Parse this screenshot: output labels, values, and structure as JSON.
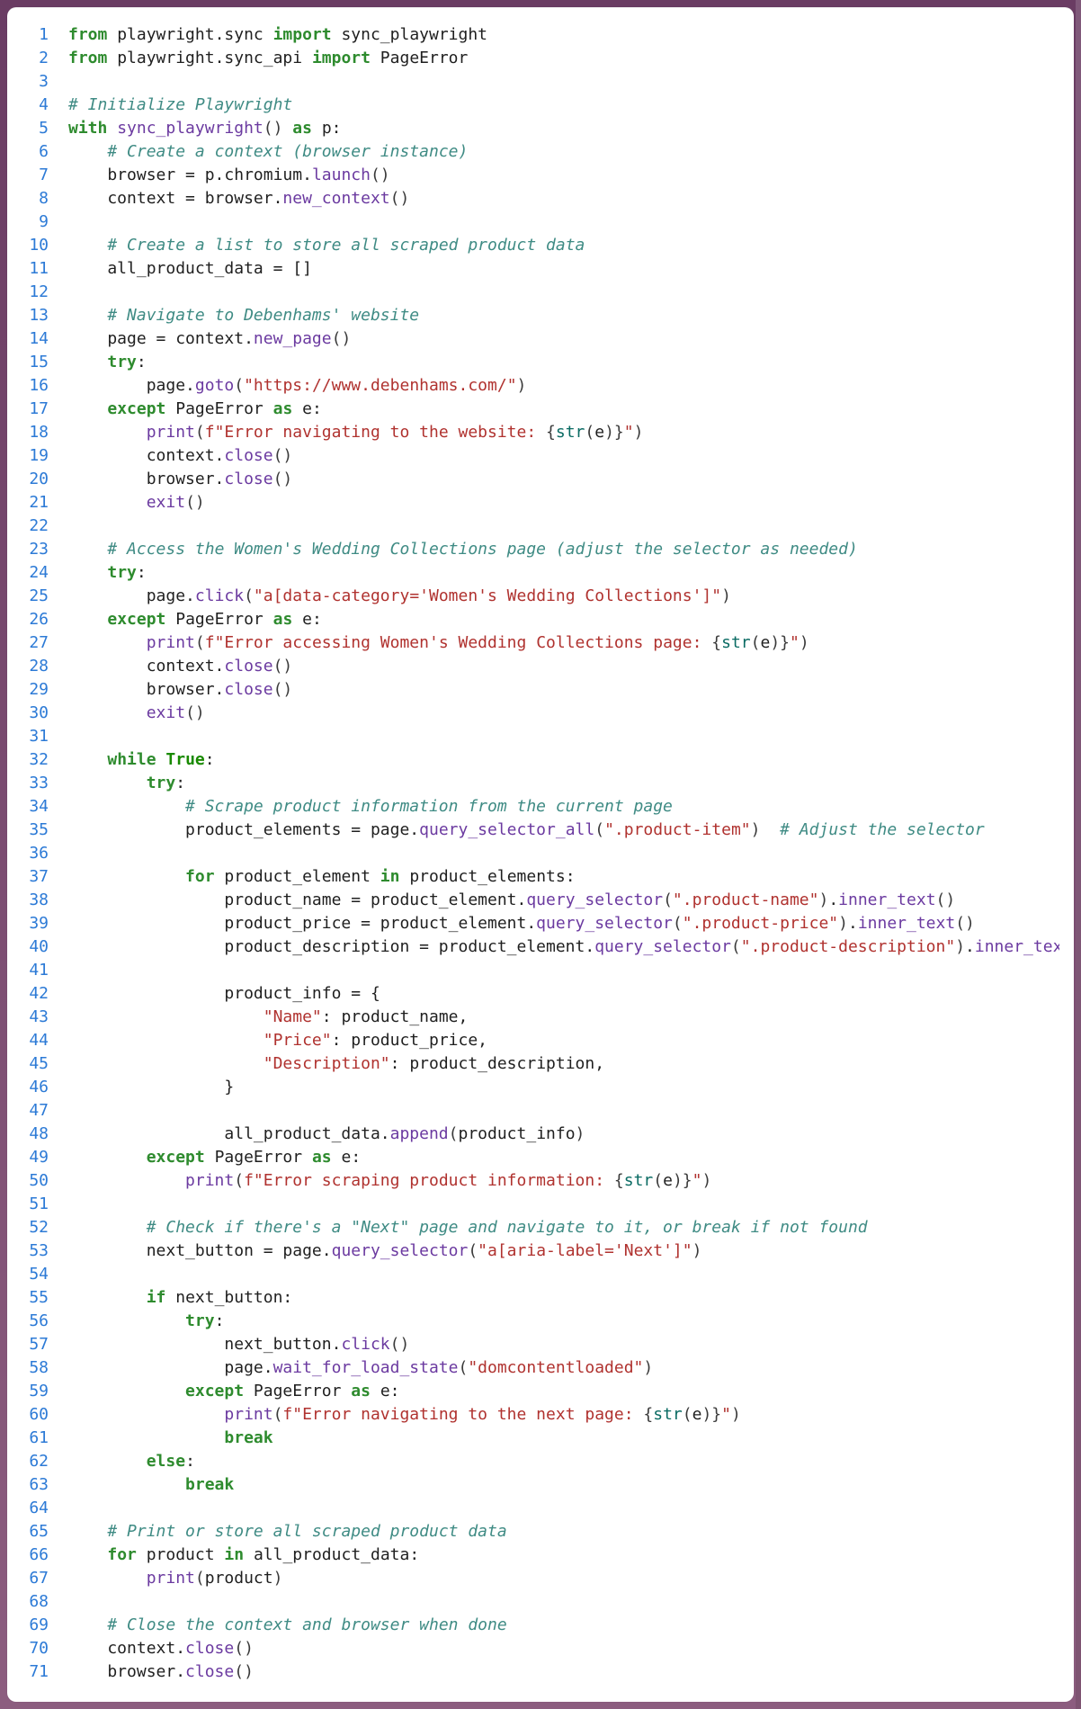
{
  "lines": [
    {
      "n": 1,
      "tokens": [
        [
          "kw",
          "from"
        ],
        [
          "pln",
          " playwright.sync "
        ],
        [
          "kw",
          "import"
        ],
        [
          "pln",
          " sync_playwright"
        ]
      ]
    },
    {
      "n": 2,
      "tokens": [
        [
          "kw",
          "from"
        ],
        [
          "pln",
          " playwright.sync_api "
        ],
        [
          "kw",
          "import"
        ],
        [
          "pln",
          " PageError"
        ]
      ]
    },
    {
      "n": 3,
      "tokens": []
    },
    {
      "n": 4,
      "tokens": [
        [
          "cmt",
          "# Initialize Playwright"
        ]
      ]
    },
    {
      "n": 5,
      "tokens": [
        [
          "kw",
          "with"
        ],
        [
          "pln",
          " "
        ],
        [
          "fn",
          "sync_playwright"
        ],
        [
          "pun",
          "()"
        ],
        [
          "pln",
          " "
        ],
        [
          "kw",
          "as"
        ],
        [
          "pln",
          " p:"
        ]
      ]
    },
    {
      "n": 6,
      "tokens": [
        [
          "pln",
          "    "
        ],
        [
          "cmt",
          "# Create a context (browser instance)"
        ]
      ]
    },
    {
      "n": 7,
      "tokens": [
        [
          "pln",
          "    browser = p.chromium."
        ],
        [
          "fn",
          "launch"
        ],
        [
          "pun",
          "()"
        ]
      ]
    },
    {
      "n": 8,
      "tokens": [
        [
          "pln",
          "    context = browser."
        ],
        [
          "fn",
          "new_context"
        ],
        [
          "pun",
          "()"
        ]
      ]
    },
    {
      "n": 9,
      "tokens": []
    },
    {
      "n": 10,
      "tokens": [
        [
          "pln",
          "    "
        ],
        [
          "cmt",
          "# Create a list to store all scraped product data"
        ]
      ]
    },
    {
      "n": 11,
      "tokens": [
        [
          "pln",
          "    all_product_data = []"
        ]
      ]
    },
    {
      "n": 12,
      "tokens": []
    },
    {
      "n": 13,
      "tokens": [
        [
          "pln",
          "    "
        ],
        [
          "cmt",
          "# Navigate to Debenhams' website"
        ]
      ]
    },
    {
      "n": 14,
      "tokens": [
        [
          "pln",
          "    page = context."
        ],
        [
          "fn",
          "new_page"
        ],
        [
          "pun",
          "()"
        ]
      ]
    },
    {
      "n": 15,
      "tokens": [
        [
          "pln",
          "    "
        ],
        [
          "kw",
          "try"
        ],
        [
          "pln",
          ":"
        ]
      ]
    },
    {
      "n": 16,
      "tokens": [
        [
          "pln",
          "        page."
        ],
        [
          "fn",
          "goto"
        ],
        [
          "pun",
          "("
        ],
        [
          "str",
          "\"https://www.debenhams.com/\""
        ],
        [
          "pun",
          ")"
        ]
      ]
    },
    {
      "n": 17,
      "tokens": [
        [
          "pln",
          "    "
        ],
        [
          "kw",
          "except"
        ],
        [
          "pln",
          " PageError "
        ],
        [
          "kw",
          "as"
        ],
        [
          "pln",
          " e:"
        ]
      ]
    },
    {
      "n": 18,
      "tokens": [
        [
          "pln",
          "        "
        ],
        [
          "fn",
          "print"
        ],
        [
          "pun",
          "("
        ],
        [
          "str",
          "f\"Error navigating to the website: "
        ],
        [
          "pun",
          "{"
        ],
        [
          "type",
          "str"
        ],
        [
          "pun",
          "("
        ],
        [
          "pln",
          "e"
        ],
        [
          "pun",
          ")}"
        ],
        [
          "str",
          "\""
        ],
        [
          "pun",
          ")"
        ]
      ]
    },
    {
      "n": 19,
      "tokens": [
        [
          "pln",
          "        context."
        ],
        [
          "fn",
          "close"
        ],
        [
          "pun",
          "()"
        ]
      ]
    },
    {
      "n": 20,
      "tokens": [
        [
          "pln",
          "        browser."
        ],
        [
          "fn",
          "close"
        ],
        [
          "pun",
          "()"
        ]
      ]
    },
    {
      "n": 21,
      "tokens": [
        [
          "pln",
          "        "
        ],
        [
          "fn",
          "exit"
        ],
        [
          "pun",
          "()"
        ]
      ]
    },
    {
      "n": 22,
      "tokens": []
    },
    {
      "n": 23,
      "tokens": [
        [
          "pln",
          "    "
        ],
        [
          "cmt",
          "# Access the Women's Wedding Collections page (adjust the selector as needed)"
        ]
      ]
    },
    {
      "n": 24,
      "tokens": [
        [
          "pln",
          "    "
        ],
        [
          "kw",
          "try"
        ],
        [
          "pln",
          ":"
        ]
      ]
    },
    {
      "n": 25,
      "tokens": [
        [
          "pln",
          "        page."
        ],
        [
          "fn",
          "click"
        ],
        [
          "pun",
          "("
        ],
        [
          "str",
          "\"a[data-category='Women's Wedding Collections']\""
        ],
        [
          "pun",
          ")"
        ]
      ]
    },
    {
      "n": 26,
      "tokens": [
        [
          "pln",
          "    "
        ],
        [
          "kw",
          "except"
        ],
        [
          "pln",
          " PageError "
        ],
        [
          "kw",
          "as"
        ],
        [
          "pln",
          " e:"
        ]
      ]
    },
    {
      "n": 27,
      "tokens": [
        [
          "pln",
          "        "
        ],
        [
          "fn",
          "print"
        ],
        [
          "pun",
          "("
        ],
        [
          "str",
          "f\"Error accessing Women's Wedding Collections page: "
        ],
        [
          "pun",
          "{"
        ],
        [
          "type",
          "str"
        ],
        [
          "pun",
          "("
        ],
        [
          "pln",
          "e"
        ],
        [
          "pun",
          ")}"
        ],
        [
          "str",
          "\""
        ],
        [
          "pun",
          ")"
        ]
      ]
    },
    {
      "n": 28,
      "tokens": [
        [
          "pln",
          "        context."
        ],
        [
          "fn",
          "close"
        ],
        [
          "pun",
          "()"
        ]
      ]
    },
    {
      "n": 29,
      "tokens": [
        [
          "pln",
          "        browser."
        ],
        [
          "fn",
          "close"
        ],
        [
          "pun",
          "()"
        ]
      ]
    },
    {
      "n": 30,
      "tokens": [
        [
          "pln",
          "        "
        ],
        [
          "fn",
          "exit"
        ],
        [
          "pun",
          "()"
        ]
      ]
    },
    {
      "n": 31,
      "tokens": []
    },
    {
      "n": 32,
      "tokens": [
        [
          "pln",
          "    "
        ],
        [
          "kw",
          "while"
        ],
        [
          "pln",
          " "
        ],
        [
          "bool",
          "True"
        ],
        [
          "pln",
          ":"
        ]
      ]
    },
    {
      "n": 33,
      "tokens": [
        [
          "pln",
          "        "
        ],
        [
          "kw",
          "try"
        ],
        [
          "pln",
          ":"
        ]
      ]
    },
    {
      "n": 34,
      "tokens": [
        [
          "pln",
          "            "
        ],
        [
          "cmt",
          "# Scrape product information from the current page"
        ]
      ]
    },
    {
      "n": 35,
      "tokens": [
        [
          "pln",
          "            product_elements = page."
        ],
        [
          "fn",
          "query_selector_all"
        ],
        [
          "pun",
          "("
        ],
        [
          "str",
          "\".product-item\""
        ],
        [
          "pun",
          ")"
        ],
        [
          "pln",
          "  "
        ],
        [
          "cmt",
          "# Adjust the selector"
        ]
      ]
    },
    {
      "n": 36,
      "tokens": []
    },
    {
      "n": 37,
      "tokens": [
        [
          "pln",
          "            "
        ],
        [
          "kw",
          "for"
        ],
        [
          "pln",
          " product_element "
        ],
        [
          "kw",
          "in"
        ],
        [
          "pln",
          " product_elements:"
        ]
      ]
    },
    {
      "n": 38,
      "tokens": [
        [
          "pln",
          "                product_name = product_element."
        ],
        [
          "fn",
          "query_selector"
        ],
        [
          "pun",
          "("
        ],
        [
          "str",
          "\".product-name\""
        ],
        [
          "pun",
          ")"
        ],
        [
          "pln",
          "."
        ],
        [
          "fn",
          "inner_text"
        ],
        [
          "pun",
          "()"
        ]
      ]
    },
    {
      "n": 39,
      "tokens": [
        [
          "pln",
          "                product_price = product_element."
        ],
        [
          "fn",
          "query_selector"
        ],
        [
          "pun",
          "("
        ],
        [
          "str",
          "\".product-price\""
        ],
        [
          "pun",
          ")"
        ],
        [
          "pln",
          "."
        ],
        [
          "fn",
          "inner_text"
        ],
        [
          "pun",
          "()"
        ]
      ]
    },
    {
      "n": 40,
      "tokens": [
        [
          "pln",
          "                product_description = product_element."
        ],
        [
          "fn",
          "query_selector"
        ],
        [
          "pun",
          "("
        ],
        [
          "str",
          "\".product-description\""
        ],
        [
          "pun",
          ")"
        ],
        [
          "pln",
          "."
        ],
        [
          "fn",
          "inner_text"
        ],
        [
          "pun",
          "()"
        ]
      ]
    },
    {
      "n": 41,
      "tokens": []
    },
    {
      "n": 42,
      "tokens": [
        [
          "pln",
          "                product_info = {"
        ]
      ]
    },
    {
      "n": 43,
      "tokens": [
        [
          "pln",
          "                    "
        ],
        [
          "str",
          "\"Name\""
        ],
        [
          "pln",
          ": product_name,"
        ]
      ]
    },
    {
      "n": 44,
      "tokens": [
        [
          "pln",
          "                    "
        ],
        [
          "str",
          "\"Price\""
        ],
        [
          "pln",
          ": product_price,"
        ]
      ]
    },
    {
      "n": 45,
      "tokens": [
        [
          "pln",
          "                    "
        ],
        [
          "str",
          "\"Description\""
        ],
        [
          "pln",
          ": product_description,"
        ]
      ]
    },
    {
      "n": 46,
      "tokens": [
        [
          "pln",
          "                }"
        ]
      ]
    },
    {
      "n": 47,
      "tokens": []
    },
    {
      "n": 48,
      "tokens": [
        [
          "pln",
          "                all_product_data."
        ],
        [
          "fn",
          "append"
        ],
        [
          "pun",
          "("
        ],
        [
          "pln",
          "product_info"
        ],
        [
          "pun",
          ")"
        ]
      ]
    },
    {
      "n": 49,
      "tokens": [
        [
          "pln",
          "        "
        ],
        [
          "kw",
          "except"
        ],
        [
          "pln",
          " PageError "
        ],
        [
          "kw",
          "as"
        ],
        [
          "pln",
          " e:"
        ]
      ]
    },
    {
      "n": 50,
      "tokens": [
        [
          "pln",
          "            "
        ],
        [
          "fn",
          "print"
        ],
        [
          "pun",
          "("
        ],
        [
          "str",
          "f\"Error scraping product information: "
        ],
        [
          "pun",
          "{"
        ],
        [
          "type",
          "str"
        ],
        [
          "pun",
          "("
        ],
        [
          "pln",
          "e"
        ],
        [
          "pun",
          ")}"
        ],
        [
          "str",
          "\""
        ],
        [
          "pun",
          ")"
        ]
      ]
    },
    {
      "n": 51,
      "tokens": []
    },
    {
      "n": 52,
      "tokens": [
        [
          "pln",
          "        "
        ],
        [
          "cmt",
          "# Check if there's a \"Next\" page and navigate to it, or break if not found"
        ]
      ]
    },
    {
      "n": 53,
      "tokens": [
        [
          "pln",
          "        next_button = page."
        ],
        [
          "fn",
          "query_selector"
        ],
        [
          "pun",
          "("
        ],
        [
          "str",
          "\"a[aria-label='Next']\""
        ],
        [
          "pun",
          ")"
        ]
      ]
    },
    {
      "n": 54,
      "tokens": []
    },
    {
      "n": 55,
      "tokens": [
        [
          "pln",
          "        "
        ],
        [
          "kw",
          "if"
        ],
        [
          "pln",
          " next_button:"
        ]
      ]
    },
    {
      "n": 56,
      "tokens": [
        [
          "pln",
          "            "
        ],
        [
          "kw",
          "try"
        ],
        [
          "pln",
          ":"
        ]
      ]
    },
    {
      "n": 57,
      "tokens": [
        [
          "pln",
          "                next_button."
        ],
        [
          "fn",
          "click"
        ],
        [
          "pun",
          "()"
        ]
      ]
    },
    {
      "n": 58,
      "tokens": [
        [
          "pln",
          "                page."
        ],
        [
          "fn",
          "wait_for_load_state"
        ],
        [
          "pun",
          "("
        ],
        [
          "str",
          "\"domcontentloaded\""
        ],
        [
          "pun",
          ")"
        ]
      ]
    },
    {
      "n": 59,
      "tokens": [
        [
          "pln",
          "            "
        ],
        [
          "kw",
          "except"
        ],
        [
          "pln",
          " PageError "
        ],
        [
          "kw",
          "as"
        ],
        [
          "pln",
          " e:"
        ]
      ]
    },
    {
      "n": 60,
      "tokens": [
        [
          "pln",
          "                "
        ],
        [
          "fn",
          "print"
        ],
        [
          "pun",
          "("
        ],
        [
          "str",
          "f\"Error navigating to the next page: "
        ],
        [
          "pun",
          "{"
        ],
        [
          "type",
          "str"
        ],
        [
          "pun",
          "("
        ],
        [
          "pln",
          "e"
        ],
        [
          "pun",
          ")}"
        ],
        [
          "str",
          "\""
        ],
        [
          "pun",
          ")"
        ]
      ]
    },
    {
      "n": 61,
      "tokens": [
        [
          "pln",
          "                "
        ],
        [
          "kw",
          "break"
        ]
      ]
    },
    {
      "n": 62,
      "tokens": [
        [
          "pln",
          "        "
        ],
        [
          "kw",
          "else"
        ],
        [
          "pln",
          ":"
        ]
      ]
    },
    {
      "n": 63,
      "tokens": [
        [
          "pln",
          "            "
        ],
        [
          "kw",
          "break"
        ]
      ]
    },
    {
      "n": 64,
      "tokens": []
    },
    {
      "n": 65,
      "tokens": [
        [
          "pln",
          "    "
        ],
        [
          "cmt",
          "# Print or store all scraped product data"
        ]
      ]
    },
    {
      "n": 66,
      "tokens": [
        [
          "pln",
          "    "
        ],
        [
          "kw",
          "for"
        ],
        [
          "pln",
          " product "
        ],
        [
          "kw",
          "in"
        ],
        [
          "pln",
          " all_product_data:"
        ]
      ]
    },
    {
      "n": 67,
      "tokens": [
        [
          "pln",
          "        "
        ],
        [
          "fn",
          "print"
        ],
        [
          "pun",
          "("
        ],
        [
          "pln",
          "product"
        ],
        [
          "pun",
          ")"
        ]
      ]
    },
    {
      "n": 68,
      "tokens": []
    },
    {
      "n": 69,
      "tokens": [
        [
          "pln",
          "    "
        ],
        [
          "cmt",
          "# Close the context and browser when done"
        ]
      ]
    },
    {
      "n": 70,
      "tokens": [
        [
          "pln",
          "    context."
        ],
        [
          "fn",
          "close"
        ],
        [
          "pun",
          "()"
        ]
      ]
    },
    {
      "n": 71,
      "tokens": [
        [
          "pln",
          "    browser."
        ],
        [
          "fn",
          "close"
        ],
        [
          "pun",
          "()"
        ]
      ]
    }
  ]
}
